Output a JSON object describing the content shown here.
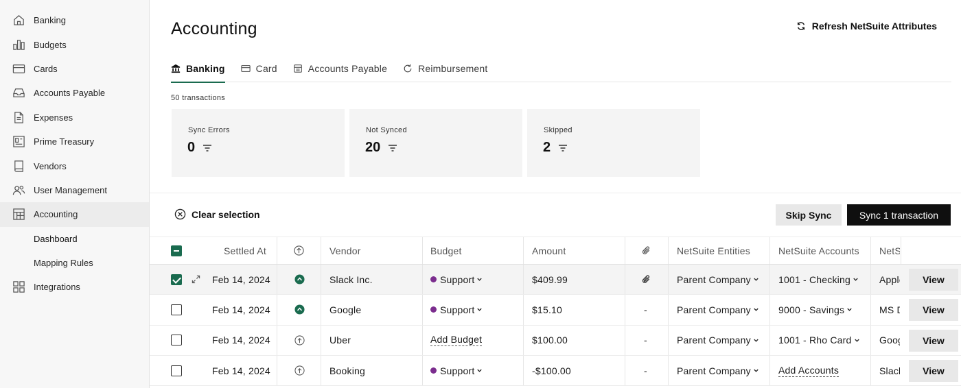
{
  "sidebar": {
    "items": [
      {
        "label": "Banking",
        "icon": "home-icon"
      },
      {
        "label": "Budgets",
        "icon": "bar-chart-icon"
      },
      {
        "label": "Cards",
        "icon": "credit-card-icon"
      },
      {
        "label": "Accounts Payable",
        "icon": "inbox-icon"
      },
      {
        "label": "Expenses",
        "icon": "receipt-icon"
      },
      {
        "label": "Prime Treasury",
        "icon": "treasury-icon"
      },
      {
        "label": "Vendors",
        "icon": "book-icon"
      },
      {
        "label": "User Management",
        "icon": "users-icon"
      },
      {
        "label": "Accounting",
        "icon": "building-icon"
      },
      {
        "label": "Dashboard"
      },
      {
        "label": "Mapping Rules"
      },
      {
        "label": "Integrations",
        "icon": "grid-icon"
      }
    ]
  },
  "header": {
    "title": "Accounting",
    "refresh_label": "Refresh NetSuite Attributes"
  },
  "tabs": [
    {
      "label": "Banking",
      "icon": "bank-icon"
    },
    {
      "label": "Card",
      "icon": "card-icon"
    },
    {
      "label": "Accounts Payable",
      "icon": "invoice-icon"
    },
    {
      "label": "Reimbursement",
      "icon": "refresh-icon"
    }
  ],
  "transaction_count": "50 transactions",
  "stats": [
    {
      "label": "Sync Errors",
      "value": "0"
    },
    {
      "label": "Not Synced",
      "value": "20"
    },
    {
      "label": "Skipped",
      "value": "2"
    }
  ],
  "actions": {
    "clear_selection": "Clear selection",
    "skip_sync": "Skip Sync",
    "sync": "Sync 1 transaction"
  },
  "table": {
    "columns": {
      "settled_at": "Settled At",
      "vendor": "Vendor",
      "budget": "Budget",
      "amount": "Amount",
      "entities": "NetSuite Entities",
      "accounts": "NetSuite Accounts",
      "vendor_ns": "NetSuite Vendors"
    },
    "rows": [
      {
        "date": "Feb 14, 2024",
        "vendor": "Slack Inc.",
        "budget": "Support",
        "amount": "$409.99",
        "attachment": "",
        "entity": "Parent Company",
        "account": "1001 - Checking",
        "ns_vendor": "Apple Inc.",
        "view": "View"
      },
      {
        "date": "Feb 14, 2024",
        "vendor": "Google",
        "budget": "Support",
        "amount": "$15.10",
        "attachment": "-",
        "entity": "Parent Company",
        "account": "9000 - Savings",
        "ns_vendor": "MS Dynamics",
        "view": "View"
      },
      {
        "date": "Feb 14, 2024",
        "vendor": "Uber",
        "budget": "Add Budget",
        "amount": "$100.00",
        "attachment": "-",
        "entity": "Parent Company",
        "account": "1001 - Rho Card",
        "ns_vendor": "Google",
        "view": "View"
      },
      {
        "date": "Feb 14, 2024",
        "vendor": "Booking",
        "budget": "Support",
        "amount": "-$100.00",
        "attachment": "-",
        "entity": "Parent Company",
        "account": "Add Accounts",
        "ns_vendor": "Slack",
        "view": "View"
      }
    ]
  },
  "colors": {
    "accent": "#1a6b4f",
    "budget_dot": "#7b2d8e",
    "primary_button": "#0f0f0f"
  }
}
